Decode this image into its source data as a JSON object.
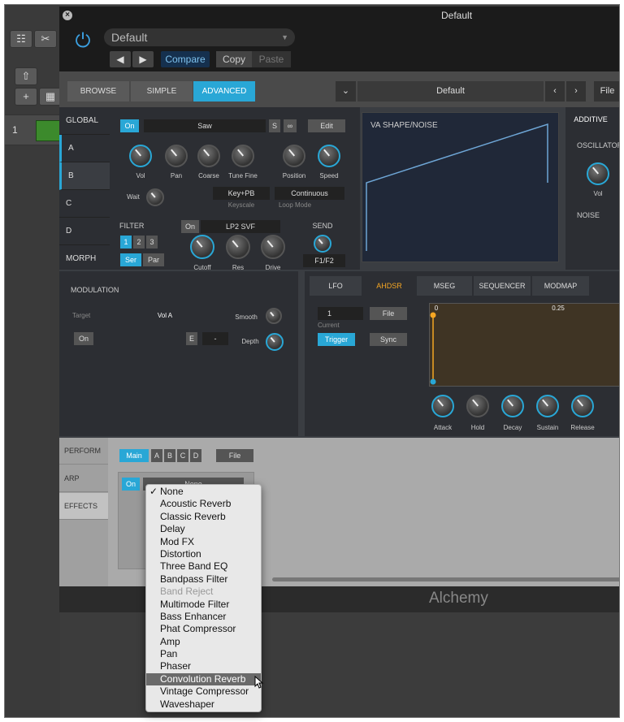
{
  "window_title": "Default",
  "header": {
    "preset": "Default",
    "compare": "Compare",
    "copy": "Copy",
    "paste": "Paste"
  },
  "view_tabs": [
    "BROWSE",
    "SIMPLE",
    "ADVANCED"
  ],
  "preset_bar": {
    "name": "Default",
    "file": "File"
  },
  "side_tabs": [
    "GLOBAL",
    "A",
    "B",
    "C",
    "D",
    "MORPH"
  ],
  "osc": {
    "on": "On",
    "wave": "Saw",
    "s": "S",
    "edit": "Edit",
    "knobs": [
      "Vol",
      "Pan",
      "Coarse",
      "Tune Fine",
      "Position",
      "Speed"
    ],
    "wait": "Wait",
    "keyscale_val": "Key+PB",
    "keyscale": "Keyscale",
    "loopmode_val": "Continuous",
    "loopmode": "Loop Mode"
  },
  "filter": {
    "label": "FILTER",
    "nums": [
      "1",
      "2",
      "3"
    ],
    "ser": "Ser",
    "par": "Par",
    "on": "On",
    "type": "LP2 SVF",
    "knobs": [
      "Cutoff",
      "Res",
      "Drive"
    ],
    "send": "SEND",
    "send_val": "F1/F2"
  },
  "wave_label": "VA SHAPE/NOISE",
  "additive": {
    "tab": "ADDITIVE",
    "osc": "OSCILLATOR",
    "vol": "Vol",
    "noise": "NOISE"
  },
  "modulation": {
    "title": "MODULATION",
    "target_label": "Target",
    "target": "Vol A",
    "smooth": "Smooth",
    "on": "On",
    "e": "E",
    "dash": "-",
    "depth": "Depth"
  },
  "env_tabs": [
    "LFO",
    "AHDSR",
    "MSEG",
    "SEQUENCER",
    "MODMAP"
  ],
  "envelope": {
    "num": "1",
    "current": "Current",
    "file": "File",
    "trigger": "Trigger",
    "sync": "Sync",
    "scale0": "0",
    "scale1": "0.25",
    "knobs": [
      "Attack",
      "Hold",
      "Decay",
      "Sustain",
      "Release"
    ]
  },
  "bottom_tabs": [
    "PERFORM",
    "ARP",
    "EFFECTS"
  ],
  "effects": {
    "main": "Main",
    "slots": [
      "A",
      "B",
      "C",
      "D"
    ],
    "file": "File",
    "on": "On",
    "slot_value": "None"
  },
  "logo": "Alchemy",
  "track": {
    "number": "1"
  },
  "effect_menu": [
    "None",
    "Acoustic Reverb",
    "Classic Reverb",
    "Delay",
    "Mod FX",
    "Distortion",
    "Three Band EQ",
    "Bandpass Filter",
    "Band Reject",
    "Multimode Filter",
    "Bass Enhancer",
    "Phat Compressor",
    "Amp",
    "Pan",
    "Phaser",
    "Convolution Reverb",
    "Vintage Compressor",
    "Waveshaper"
  ],
  "menu_checked": "None",
  "menu_disabled": "Band Reject",
  "menu_selected": "Convolution Reverb",
  "colors": {
    "accent": "#29a7d6",
    "envelope": "#f5a623"
  }
}
